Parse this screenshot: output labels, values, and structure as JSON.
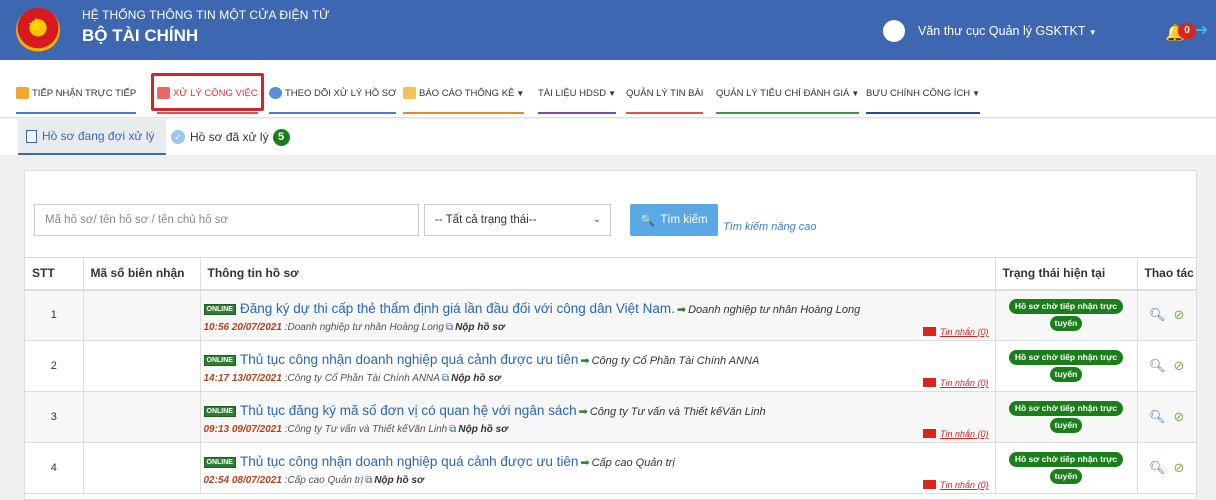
{
  "header": {
    "system_title": "HỆ THỐNG THÔNG TIN MỘT CỬA ĐIỆN TỬ",
    "org_title": "BỘ TÀI CHÍNH",
    "user_name": "Văn thư cục Quản lý GSKTKT",
    "notification_count": "0"
  },
  "menu": [
    {
      "label": "TIẾP NHẬN TRỰC TIẾP",
      "icon": "receive-icon",
      "dropdown": false
    },
    {
      "label": "XỬ LÝ CÔNG VIỆC",
      "icon": "task-icon",
      "dropdown": false,
      "active": true
    },
    {
      "label": "THEO DÕI XỬ LÝ HỒ SƠ",
      "icon": "monitor-icon",
      "dropdown": false
    },
    {
      "label": "BÁO CÁO THỐNG KÊ",
      "icon": "report-icon",
      "dropdown": true
    },
    {
      "label": "TÀI LIỆU HDSD",
      "icon": "",
      "dropdown": true
    },
    {
      "label": "QUẢN LÝ TIN BÀI",
      "icon": "",
      "dropdown": false
    },
    {
      "label": "QUẢN LÝ TIÊU CHÍ ĐÁNH GIÁ",
      "icon": "",
      "dropdown": true
    },
    {
      "label": "BƯU CHÍNH CÔNG ÍCH",
      "icon": "",
      "dropdown": true
    }
  ],
  "tabs": {
    "pending": {
      "label": "Hồ sơ đang đợi xử lý"
    },
    "done": {
      "label": "Hồ sơ đã xử lý",
      "count": "5"
    }
  },
  "search": {
    "placeholder": "Mã hồ sơ/ tên hồ sơ / tên chủ hồ sơ",
    "status_value": "-- Tất cả trạng thái--",
    "button_label": "Tìm kiếm",
    "advanced_label": "Tìm kiếm nâng cao"
  },
  "table": {
    "headers": [
      "STT",
      "Mã số biên nhận",
      "Thông tin hồ sơ",
      "Trạng thái hiện tại",
      "Thao tác"
    ],
    "online_tag": "ONLINE",
    "submit_label": "Nộp hồ sơ",
    "messages_label": "Tin nhắn (0)",
    "status_line1": "Hồ sơ chờ tiếp nhận trực",
    "status_line2": "tuyến",
    "rows": [
      {
        "stt": "1",
        "receipt": "",
        "procedure": "Đăng ký dự thi cấp thẻ thẩm định giá lần đầu đối với công dân Việt Nam.",
        "org": "Doanh nghiệp tư nhân Hoàng Long",
        "time": "10:56 20/07/2021",
        "sub_org": ":Doanh nghiệp tư nhân Hoàng Long"
      },
      {
        "stt": "2",
        "receipt": "",
        "procedure": "Thủ tục công nhận doanh nghiệp quá cảnh được ưu tiên",
        "org": "Công ty Cổ Phần Tài Chính ANNA",
        "time": "14:17 13/07/2021",
        "sub_org": ":Công ty Cổ Phần Tài Chính ANNA"
      },
      {
        "stt": "3",
        "receipt": "",
        "procedure": "Thủ tục đăng ký mã số đơn vị có quan hệ với ngân sách",
        "org": "Công ty Tư vấn và Thiết kếVăn Linh",
        "time": "09:13 09/07/2021",
        "sub_org": ":Công ty Tư vấn và Thiết kếVăn Linh"
      },
      {
        "stt": "4",
        "receipt": "",
        "procedure": "Thủ tục công nhận doanh nghiệp quá cảnh được ưu tiên",
        "org": "Cấp cao Quản trị",
        "time": "02:54 08/07/2021",
        "sub_org": ":Cấp cao Quản trị"
      }
    ]
  }
}
